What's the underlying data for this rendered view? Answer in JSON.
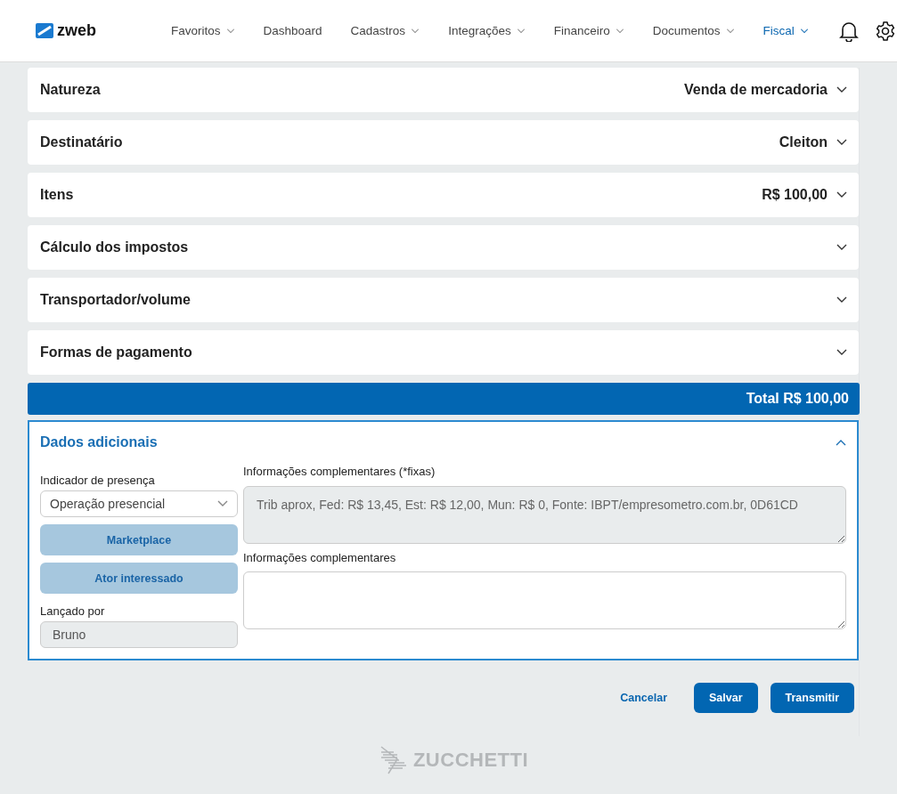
{
  "header": {
    "logo": "zweb",
    "nav": [
      {
        "label": "Favoritos",
        "dropdown": true,
        "selected": false
      },
      {
        "label": "Dashboard",
        "dropdown": false,
        "selected": false
      },
      {
        "label": "Cadastros",
        "dropdown": true,
        "selected": false
      },
      {
        "label": "Integrações",
        "dropdown": true,
        "selected": false
      },
      {
        "label": "Financeiro",
        "dropdown": true,
        "selected": false
      },
      {
        "label": "Documentos",
        "dropdown": true,
        "selected": false
      },
      {
        "label": "Fiscal",
        "dropdown": true,
        "selected": true
      }
    ]
  },
  "sections": [
    {
      "title": "Natureza",
      "value": "Venda de mercadoria",
      "expanded": false
    },
    {
      "title": "Destinatário",
      "value": "Cleiton",
      "expanded": false
    },
    {
      "title": "Itens",
      "value": "R$ 100,00",
      "expanded": false
    },
    {
      "title": "Cálculo dos impostos",
      "expanded": false
    },
    {
      "title": "Transportador/volume",
      "expanded": false
    },
    {
      "title": "Formas de pagamento",
      "expanded": false
    }
  ],
  "total": "Total R$ 100,00",
  "additional": {
    "title": "Dados adicionais",
    "expanded": true,
    "presence_label": "Indicador de presença",
    "presence_value": "Operação presencial",
    "buttons": [
      "Marketplace",
      "Ator interessado"
    ],
    "launched_label": "Lançado por",
    "launched_value": "Bruno",
    "fixed_label": "Informações complementares (*fixas)",
    "fixed_value": "Trib aprox, Fed: R$ 13,45, Est: R$ 12,00, Mun: R$ 0, Fonte: IBPT/empresometro.com.br, 0D61CD",
    "extra_label": "Informações complementares"
  },
  "actions": {
    "cancel": "Cancelar",
    "save": "Salvar",
    "transmit": "Transmitir"
  },
  "footer": {
    "brand": "ZUCCHETTI"
  }
}
